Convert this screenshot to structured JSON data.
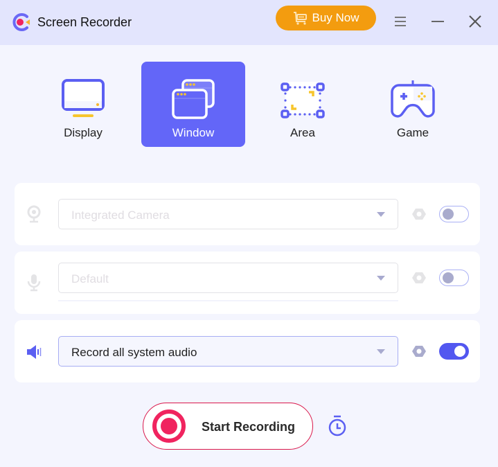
{
  "window": {
    "title": "Screen Recorder",
    "buy_label": "Buy Now",
    "icons": {
      "logo": "app-logo",
      "cart": "cart-icon",
      "menu": "hamburger-menu-icon",
      "minimize": "minimize-icon",
      "close": "close-icon"
    }
  },
  "modes": {
    "selected": "Window",
    "items": [
      {
        "label": "Display",
        "icon": "monitor-icon"
      },
      {
        "label": "Window",
        "icon": "windows-icon"
      },
      {
        "label": "Area",
        "icon": "area-select-icon"
      },
      {
        "label": "Game",
        "icon": "gamepad-icon"
      }
    ]
  },
  "sources": {
    "camera": {
      "icon": "webcam-icon",
      "value": "Integrated Camera",
      "enabled": false
    },
    "microphone": {
      "icon": "microphone-icon",
      "value": "Default",
      "enabled": false
    },
    "system_audio": {
      "icon": "speaker-icon",
      "value": "Record all system audio",
      "enabled": true
    }
  },
  "actions": {
    "start_label": "Start Recording",
    "timer_icon": "stopwatch-icon"
  },
  "colors": {
    "accent": "#6366f8",
    "buy": "#f39c0f",
    "record": "#f0245f",
    "toggle_on": "#5257f0"
  }
}
